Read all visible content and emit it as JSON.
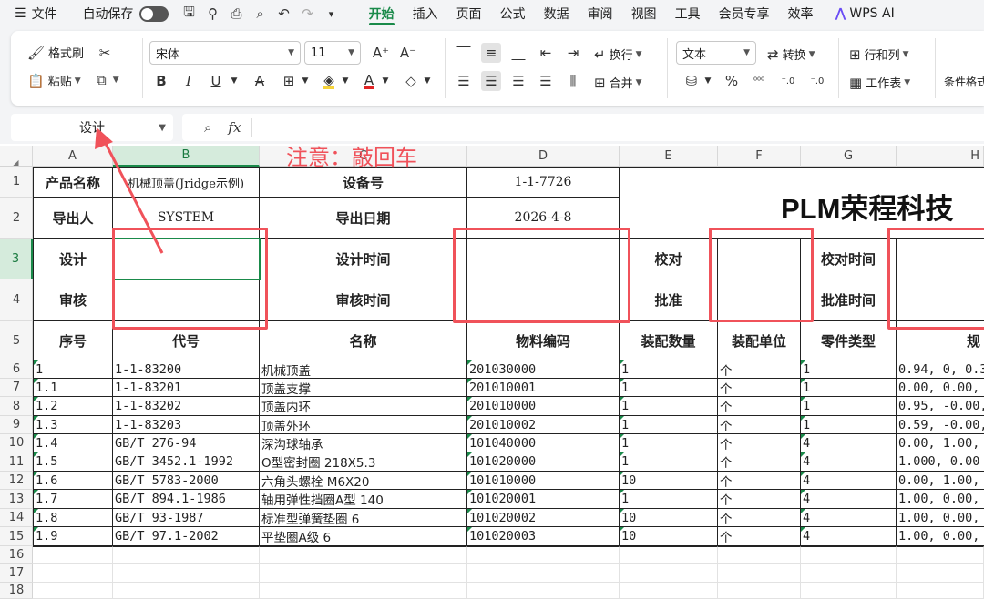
{
  "menu": {
    "file_label": "文件",
    "autosave_label": "自动保存",
    "tabs": [
      "开始",
      "插入",
      "页面",
      "公式",
      "数据",
      "审阅",
      "视图",
      "工具",
      "会员专享",
      "效率"
    ],
    "active_tab": "开始",
    "wps_ai_label": "WPS AI"
  },
  "ribbon": {
    "format_painter": "格式刷",
    "paste": "粘贴",
    "font_name": "宋体",
    "font_size": "11",
    "wrap_text": "换行",
    "merge": "合并",
    "number_format": "文本",
    "convert": "转换",
    "rows_cols": "行和列",
    "worksheet": "工作表",
    "conditional_format": "条件格式"
  },
  "formula_bar": {
    "name_box": "设计",
    "fx_label": "fx"
  },
  "annotation": {
    "note_text": "注意：敲回车",
    "color": "#f0525a"
  },
  "columns": [
    "A",
    "B",
    "C",
    "D",
    "E",
    "F",
    "G",
    "H"
  ],
  "selected_column": "B",
  "rows": [
    "1",
    "2",
    "3",
    "4",
    "5",
    "6",
    "7",
    "8",
    "9",
    "10",
    "11",
    "12",
    "13",
    "14",
    "15",
    "16",
    "17",
    "18"
  ],
  "selected_row": "3",
  "sheet": {
    "header": {
      "product_name_label": "产品名称",
      "product_name_value": "机械顶盖(Jridge示例)",
      "device_no_label": "设备号",
      "device_no_value": "1-1-7726",
      "exporter_label": "导出人",
      "exporter_value": "SYSTEM",
      "export_date_label": "导出日期",
      "export_date_value": "2026-4-8",
      "company_title": "PLM荣程科技",
      "design_label": "设计",
      "design_time_label": "设计时间",
      "check_label": "校对",
      "check_time_label": "校对时间",
      "review_label": "审核",
      "review_time_label": "审核时间",
      "approve_label": "批准",
      "approve_time_label": "批准时间"
    },
    "table_headers": [
      "序号",
      "代号",
      "名称",
      "物料编码",
      "装配数量",
      "装配单位",
      "零件类型",
      "规"
    ],
    "table_rows": [
      [
        "1",
        "1-1-83200",
        "机械顶盖",
        "201030000",
        "1",
        "个",
        "1",
        "0.94, 0, 0.3"
      ],
      [
        "1.1",
        "1-1-83201",
        "顶盖支撑",
        "201010001",
        "1",
        "个",
        "1",
        "0.00, 0.00,"
      ],
      [
        "1.2",
        "1-1-83202",
        "顶盖内环",
        "201010000",
        "1",
        "个",
        "1",
        "0.95, -0.00,"
      ],
      [
        "1.3",
        "1-1-83203",
        "顶盖外环",
        "201010002",
        "1",
        "个",
        "1",
        "0.59, -0.00,"
      ],
      [
        "1.4",
        "GB/T 276-94",
        "深沟球轴承",
        "101040000",
        "1",
        "个",
        "4",
        "0.00, 1.00,"
      ],
      [
        "1.5",
        "GB/T 3452.1-1992",
        "O型密封圈 218X5.3",
        "101020000",
        "1",
        "个",
        "4",
        "1.000, 0.00"
      ],
      [
        "1.6",
        "GB/T 5783-2000",
        "六角头螺栓 M6X20",
        "101010000",
        "10",
        "个",
        "4",
        "0.00, 1.00,"
      ],
      [
        "1.7",
        "GB/T 894.1-1986",
        "轴用弹性挡圈A型 140",
        "101020001",
        "1",
        "个",
        "4",
        "1.00, 0.00,"
      ],
      [
        "1.8",
        "GB/T 93-1987",
        "标准型弹簧垫圈 6",
        "101020002",
        "10",
        "个",
        "4",
        "1.00, 0.00,"
      ],
      [
        "1.9",
        "GB/T 97.1-2002",
        "平垫圈A级 6",
        "101020003",
        "10",
        "个",
        "4",
        "1.00, 0.00,"
      ]
    ]
  }
}
